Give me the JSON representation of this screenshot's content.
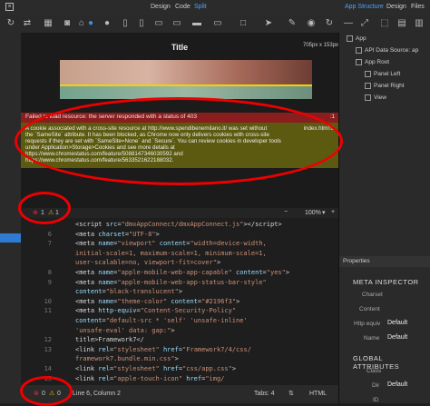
{
  "topbar": {
    "tabs": [
      {
        "label": "Design",
        "active": false
      },
      {
        "label": "Code",
        "active": false
      },
      {
        "label": "Split",
        "active": true
      }
    ],
    "right_tabs": [
      {
        "label": "App Structure",
        "active": true
      },
      {
        "label": "Design",
        "active": false
      },
      {
        "label": "Files",
        "active": false
      }
    ]
  },
  "toolbar": {
    "icons": [
      "refresh-icon",
      "sync-icon",
      "grid-icon",
      "camera-icon",
      "android-icon",
      "apple-icon",
      "apple-icon",
      "phone-icon",
      "tablet-icon",
      "desktop-icon",
      "monitor-icon",
      "cursor-icon",
      "pen-icon",
      "eye-icon",
      "refresh-icon",
      "layout-icon"
    ]
  },
  "preview": {
    "size_label": "705px x 153px",
    "app_title": "Title"
  },
  "console": {
    "error": {
      "text": "Failed to load resource: the server responded with a status of 403",
      "source": ":1"
    },
    "warning": {
      "lines": [
        "A cookie associated with a cross-site resource at http://www.spendibenemilano.it/ was set without",
        "the `SameSite` attribute. It has been blocked, as Chrome now only delivers cookies with cross-site",
        "requests if they are set with `SameSite=None` and `Secure`. You can review cookies in developer tools",
        "under Application>Storage>Cookies and see more details at",
        "https://www.chromestatus.com/feature/5088147346030592 and",
        "https://www.chromestatus.com/feature/5633521622188032."
      ],
      "source": "index.html:0"
    },
    "counts": {
      "errors": "1",
      "warnings": "1"
    },
    "zoom": "100%"
  },
  "editor": {
    "lines": [
      {
        "num": "",
        "html": "<span class='tag'>&lt;script </span><span class='attr'>src</span><span class='plain'>=</span><span class='str'>\"dmxAppConnect/dmxAppConnect.js\"</span><span class='tag'>&gt;&lt;/script&gt;</span>"
      },
      {
        "num": "6",
        "html": "<span class='tag'>&lt;meta </span><span class='attr'>charset</span><span class='plain'>=</span><span class='str'>\"UTF-8\"</span><span class='tag'>&gt;</span>"
      },
      {
        "num": "7",
        "html": "<span class='tag'>&lt;meta </span><span class='attr'>name</span><span class='plain'>=</span><span class='str'>\"viewport\"</span><span class='plain'> </span><span class='attr'>content</span><span class='plain'>=</span><span class='str'>\"width=device-width,</span>"
      },
      {
        "num": "",
        "html": "<span class='str'>initial-scale=1, maximum-scale=1, minimum-scale=1,</span>"
      },
      {
        "num": "",
        "html": "<span class='str'>user-scalable=no, viewport-fit=cover\"</span><span class='tag'>&gt;</span>"
      },
      {
        "num": "8",
        "html": "<span class='tag'>&lt;meta </span><span class='attr'>name</span><span class='plain'>=</span><span class='str'>\"apple-mobile-web-app-capable\"</span><span class='plain'> </span><span class='attr'>content</span><span class='plain'>=</span><span class='str'>\"yes\"</span><span class='tag'>&gt;</span>"
      },
      {
        "num": "9",
        "html": "<span class='tag'>&lt;meta </span><span class='attr'>name</span><span class='plain'>=</span><span class='str'>\"apple-mobile-web-app-status-bar-style\"</span>"
      },
      {
        "num": "",
        "html": "<span class='attr'>content</span><span class='plain'>=</span><span class='str'>\"black-translucent\"</span><span class='tag'>&gt;</span>"
      },
      {
        "num": "10",
        "html": "<span class='tag'>&lt;meta </span><span class='attr'>name</span><span class='plain'>=</span><span class='str'>\"theme-color\"</span><span class='plain'> </span><span class='attr'>content</span><span class='plain'>=</span><span class='str'>\"#2196f3\"</span><span class='tag'>&gt;</span>"
      },
      {
        "num": "11",
        "html": "<span class='tag'>&lt;meta </span><span class='attr'>http-equiv</span><span class='plain'>=</span><span class='str'>\"Content-Security-Policy\"</span>"
      },
      {
        "num": "",
        "html": "<span class='attr'>content</span><span class='plain'>=</span><span class='str'>\"default-src * 'self' 'unsafe-inline'</span>"
      },
      {
        "num": "",
        "html": "<span class='str'>'unsafe-eval' data: gap:\"</span><span class='tag'>&gt;</span>"
      },
      {
        "num": "12",
        "html": "<span class='plain'>title&gt;Framework7&lt;/</span>"
      },
      {
        "num": "13",
        "html": "<span class='tag'>&lt;link </span><span class='attr'>rel</span><span class='plain'>=</span><span class='str'>\"stylesheet\"</span><span class='plain'> </span><span class='attr'>href</span><span class='plain'>=</span><span class='str'>\"Framework7/4/css/</span>"
      },
      {
        "num": "",
        "html": "<span class='str'>framework7.bundle.min.css\"</span><span class='tag'>&gt;</span>"
      },
      {
        "num": "14",
        "html": "<span class='tag'>&lt;link </span><span class='attr'>rel</span><span class='plain'>=</span><span class='str'>\"stylesheet\"</span><span class='plain'> </span><span class='attr'>href</span><span class='plain'>=</span><span class='str'>\"css/app.css\"</span><span class='tag'>&gt;</span>"
      },
      {
        "num": "15",
        "html": "<span class='tag'>&lt;link </span><span class='attr'>rel</span><span class='plain'>=</span><span class='str'>\"apple-touch-icon\"</span><span class='plain'> </span><span class='attr'>href</span><span class='plain'>=</span><span class='str'>\"img/</span>"
      }
    ]
  },
  "statusbar": {
    "errors": "0",
    "warnings": "0",
    "position": "Line 6, Column 2",
    "tabs": "Tabs: 4",
    "mode": "HTML"
  },
  "structure": {
    "items": [
      {
        "label": "App",
        "level": 0
      },
      {
        "label": "API Data Source: ap",
        "level": 1
      },
      {
        "label": "App Root",
        "level": 1
      },
      {
        "label": "Panel Left",
        "level": 2
      },
      {
        "label": "Panel Right",
        "level": 2
      },
      {
        "label": "View",
        "level": 2
      }
    ]
  },
  "properties": {
    "header": "Properties",
    "meta_inspector": {
      "title": "META INSPECTOR",
      "fields": [
        {
          "label": "Charset",
          "value": ""
        },
        {
          "label": "Content",
          "value": ""
        },
        {
          "label": "Http equiv",
          "value": "Default"
        },
        {
          "label": "Name",
          "value": "Default"
        }
      ]
    },
    "global_attributes": {
      "title": "GLOBAL ATTRIBUTES",
      "fields": [
        {
          "label": "Class",
          "value": ""
        },
        {
          "label": "Dir",
          "value": "Default"
        },
        {
          "label": "ID",
          "value": ""
        }
      ]
    }
  },
  "colors": {
    "accent": "#3a8fe0",
    "error": "#8a1d1d",
    "warning": "#5c5a10",
    "annotation": "#e00000"
  }
}
